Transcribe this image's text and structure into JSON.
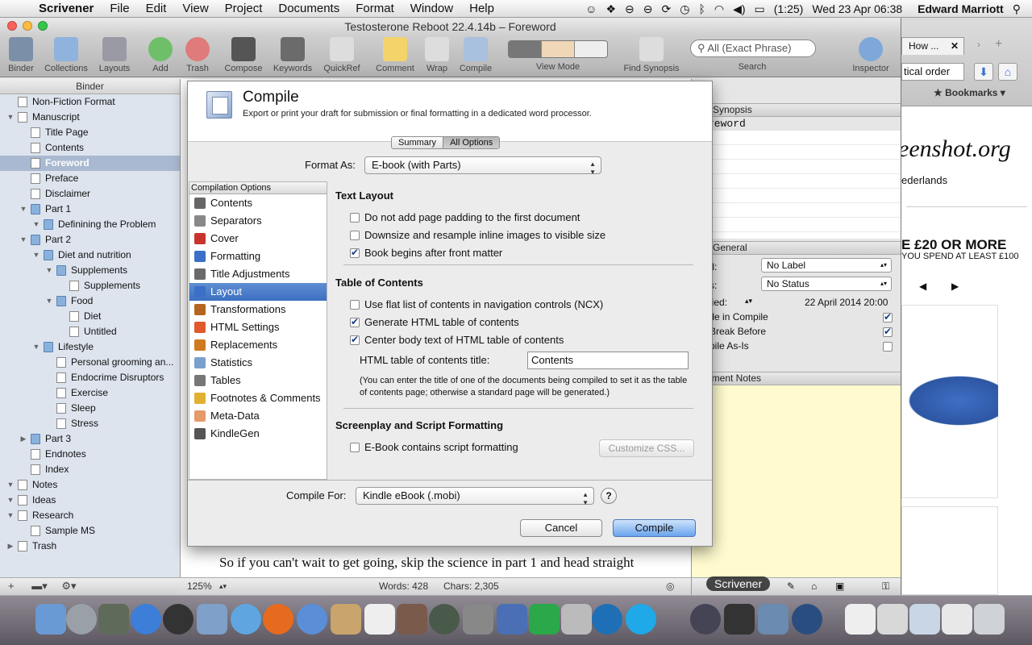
{
  "menubar": {
    "app": "Scrivener",
    "items": [
      "File",
      "Edit",
      "View",
      "Project",
      "Documents",
      "Format",
      "Window",
      "Help"
    ],
    "battery": "(1:25)",
    "clock": "Wed 23 Apr  06:38",
    "user": "Edward Marriott"
  },
  "window": {
    "title": "Testosterone Reboot 22.4.14b – Foreword"
  },
  "toolbar": {
    "binder": "Binder",
    "collections": "Collections",
    "layouts": "Layouts",
    "add": "Add",
    "trash": "Trash",
    "compose": "Compose",
    "keywords": "Keywords",
    "quickref": "QuickRef",
    "comment": "Comment",
    "wrap": "Wrap",
    "compile": "Compile",
    "view_mode": "View Mode",
    "find_synopsis": "Find Synopsis",
    "search_placeholder": "All (Exact Phrase)",
    "search_label": "Search",
    "inspector": "Inspector"
  },
  "binder": {
    "header": "Binder",
    "items": [
      {
        "label": "Non-Fiction Format"
      },
      {
        "label": "Manuscript"
      },
      {
        "label": "Title Page"
      },
      {
        "label": "Contents"
      },
      {
        "label": "Foreword"
      },
      {
        "label": "Preface"
      },
      {
        "label": "Disclaimer"
      },
      {
        "label": "Part 1"
      },
      {
        "label": "Definining the Problem"
      },
      {
        "label": "Part 2"
      },
      {
        "label": "Diet and nutrition"
      },
      {
        "label": "Supplements"
      },
      {
        "label": "Supplements"
      },
      {
        "label": "Food"
      },
      {
        "label": "Diet"
      },
      {
        "label": "Untitled"
      },
      {
        "label": "Lifestyle"
      },
      {
        "label": "Personal grooming an..."
      },
      {
        "label": "Endocrime Disruptors"
      },
      {
        "label": "Exercise"
      },
      {
        "label": "Sleep"
      },
      {
        "label": "Stress"
      },
      {
        "label": "Part 3"
      },
      {
        "label": "Endnotes"
      },
      {
        "label": "Index"
      },
      {
        "label": "Notes"
      },
      {
        "label": "Ideas"
      },
      {
        "label": "Research"
      },
      {
        "label": "Sample MS"
      },
      {
        "label": "Trash"
      }
    ]
  },
  "editor": {
    "body_text": "So if you can't wait to get going, skip the science in part 1 and head straight",
    "zoom": "125%",
    "words": "Words: 428",
    "chars": "Chars: 2,305"
  },
  "inspector": {
    "synopsis_header": "Synopsis",
    "synopsis_text": "reword",
    "general_header": "General",
    "label_caption": "bel:",
    "label_value": "No Label",
    "status_caption": "tus:",
    "status_value": "No Status",
    "modified_caption": "dified:",
    "modified_value": "22 April 2014 20:00",
    "include_compile": "lude in Compile",
    "page_break": "e Break Before",
    "compile_asis": "mpile As-Is",
    "notes_header": "cument Notes"
  },
  "browser": {
    "tab": "How ...",
    "address": "tical order",
    "bookmarks": "Bookmarks",
    "logo": "eenshot.org",
    "location": "ederlands",
    "promo_line1": "E £20 OR MORE",
    "promo_line2": "YOU SPEND AT LEAST £100"
  },
  "dock": {
    "scrivener_label": "Scrivener"
  },
  "compile": {
    "title": "Compile",
    "subtitle": "Export or print your draft for submission or final formatting in a dedicated word processor.",
    "tab_summary": "Summary",
    "tab_all": "All Options",
    "format_as_label": "Format As:",
    "format_as_value": "E-book (with Parts)",
    "options_header": "Compilation Options",
    "options": [
      "Contents",
      "Separators",
      "Cover",
      "Formatting",
      "Title Adjustments",
      "Layout",
      "Transformations",
      "HTML Settings",
      "Replacements",
      "Statistics",
      "Tables",
      "Footnotes & Comments",
      "Meta-Data",
      "KindleGen"
    ],
    "text_layout_header": "Text Layout",
    "opt_no_padding": "Do not add page padding to the first document",
    "opt_downsize": "Downsize and resample inline images to visible size",
    "opt_front_matter": "Book begins after front matter",
    "toc_header": "Table of Contents",
    "opt_flat_list": "Use flat list of contents in navigation controls (NCX)",
    "opt_generate_html": "Generate HTML table of contents",
    "opt_center_body": "Center body text of HTML table of contents",
    "toc_title_label": "HTML table of contents title:",
    "toc_title_value": "Contents",
    "toc_note": "(You can enter the title of one of the documents being compiled to set it as the table of contents page; otherwise a standard page will be generated.)",
    "screenplay_header": "Screenplay and Script Formatting",
    "opt_script": "E-Book contains script formatting",
    "customize_css": "Customize CSS...",
    "compile_for_label": "Compile For:",
    "compile_for_value": "Kindle eBook (.mobi)",
    "help": "?",
    "cancel": "Cancel",
    "compile_button": "Compile"
  }
}
